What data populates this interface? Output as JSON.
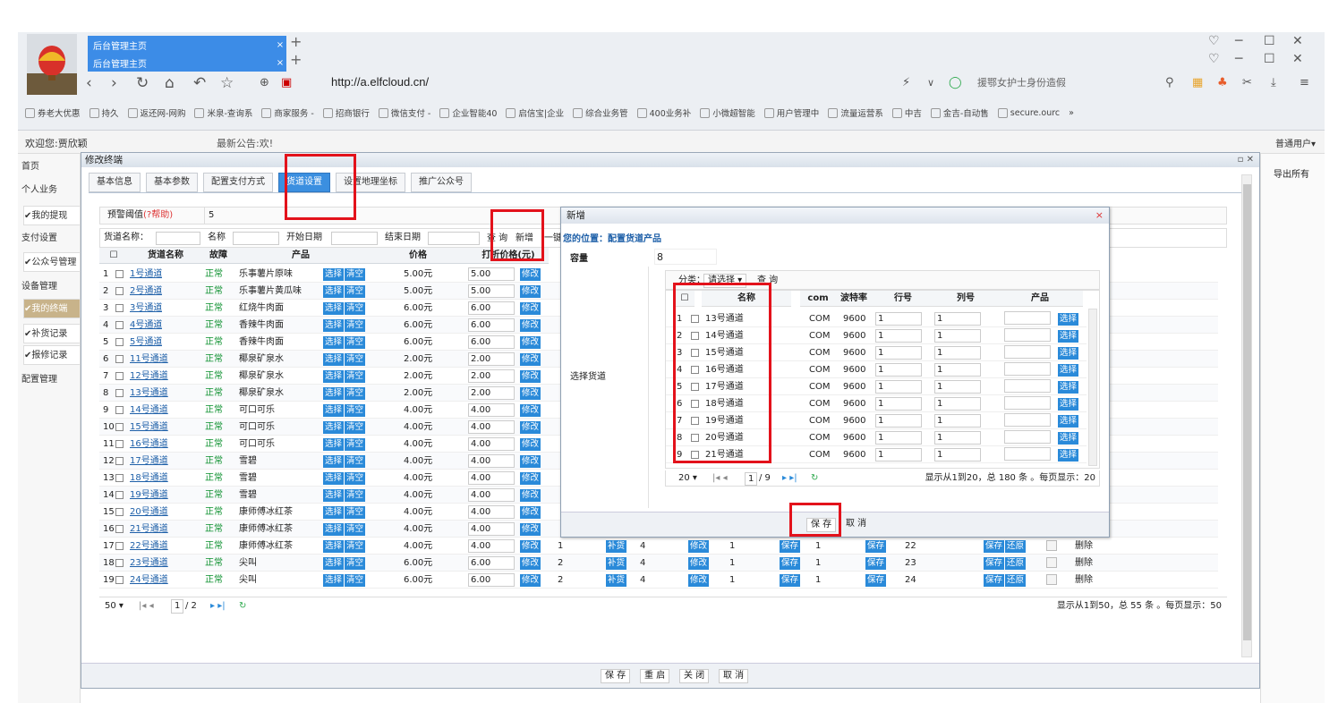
{
  "browser": {
    "tabs": [
      {
        "title": "后台管理主页",
        "close": "×"
      },
      {
        "title": "后台管理主页",
        "close": "×"
      }
    ],
    "new_tab": "+",
    "url": "http://a.elfcloud.cn/",
    "search_text": "援鄂女护士身份造假",
    "window_controls": [
      "─",
      "☐",
      "✕"
    ],
    "bookmarks": [
      "券老大优惠",
      "持久",
      "返还网-网购",
      "米泉-查询系",
      "商家服务 -",
      "招商银行",
      "微信支付 -",
      "企业智能40",
      "启信宝|企业",
      "综合业务管",
      "400业务补",
      "小微超智能",
      "用户管理中",
      "流量运营系",
      "中吉",
      "金吉-自动售",
      "secure.ourc"
    ],
    "bookmarks_more": "»"
  },
  "app": {
    "welcome": "欢迎您:贾欣颖",
    "notice": "最新公告:欢!",
    "user_type": "普通用户▾",
    "export_all": "导出所有"
  },
  "sidebar": [
    {
      "label": "首页"
    },
    {
      "label": "个人业务"
    },
    {
      "label": "✔我的提现"
    },
    {
      "label": "支付设置"
    },
    {
      "label": "✔公众号管理"
    },
    {
      "label": "设备管理"
    },
    {
      "label": "✔我的终端"
    },
    {
      "label": "✔补货记录"
    },
    {
      "label": "✔报修记录"
    },
    {
      "label": "配置管理"
    }
  ],
  "dialog": {
    "title": "修改终端",
    "tabs": [
      "基本信息",
      "基本参数",
      "配置支付方式",
      "货道设置",
      "设置地理坐标",
      "推广公众号"
    ],
    "active_tab": "货道设置",
    "warn_label": "预警阈值",
    "warn_help": "(?帮助)",
    "warn_value": "5",
    "filter": {
      "channel_name": "货道名称：",
      "name": "名称",
      "start_date": "开始日期",
      "end_date": "结束日期",
      "query": "查 询",
      "add": "新增",
      "extra": "一键"
    },
    "columns": [
      "☐",
      "货道名称",
      "故障",
      "产品",
      "价格",
      "打折价格(元)"
    ],
    "buttons": {
      "select": "选择",
      "clear": "清空",
      "modify": "修改",
      "restock": "补货",
      "save": "保存",
      "restore": "还原",
      "delete": "删除"
    },
    "rows": [
      {
        "no": "1",
        "name": "1号通道",
        "status": "正常",
        "product": "乐事薯片原味",
        "price": "5.00元",
        "discount": "5.00"
      },
      {
        "no": "2",
        "name": "2号通道",
        "status": "正常",
        "product": "乐事薯片黄瓜味",
        "price": "5.00元",
        "discount": "5.00"
      },
      {
        "no": "3",
        "name": "3号通道",
        "status": "正常",
        "product": "红烧牛肉面",
        "price": "6.00元",
        "discount": "6.00"
      },
      {
        "no": "4",
        "name": "4号通道",
        "status": "正常",
        "product": "香辣牛肉面",
        "price": "6.00元",
        "discount": "6.00"
      },
      {
        "no": "5",
        "name": "5号通道",
        "status": "正常",
        "product": "香辣牛肉面",
        "price": "6.00元",
        "discount": "6.00"
      },
      {
        "no": "6",
        "name": "11号通道",
        "status": "正常",
        "product": "椰泉矿泉水",
        "price": "2.00元",
        "discount": "2.00"
      },
      {
        "no": "7",
        "name": "12号通道",
        "status": "正常",
        "product": "椰泉矿泉水",
        "price": "2.00元",
        "discount": "2.00"
      },
      {
        "no": "8",
        "name": "13号通道",
        "status": "正常",
        "product": "椰泉矿泉水",
        "price": "2.00元",
        "discount": "2.00"
      },
      {
        "no": "9",
        "name": "14号通道",
        "status": "正常",
        "product": "可口可乐",
        "price": "4.00元",
        "discount": "4.00"
      },
      {
        "no": "10",
        "name": "15号通道",
        "status": "正常",
        "product": "可口可乐",
        "price": "4.00元",
        "discount": "4.00"
      },
      {
        "no": "11",
        "name": "16号通道",
        "status": "正常",
        "product": "可口可乐",
        "price": "4.00元",
        "discount": "4.00"
      },
      {
        "no": "12",
        "name": "17号通道",
        "status": "正常",
        "product": "雪碧",
        "price": "4.00元",
        "discount": "4.00"
      },
      {
        "no": "13",
        "name": "18号通道",
        "status": "正常",
        "product": "雪碧",
        "price": "4.00元",
        "discount": "4.00"
      },
      {
        "no": "14",
        "name": "19号通道",
        "status": "正常",
        "product": "雪碧",
        "price": "4.00元",
        "discount": "4.00"
      },
      {
        "no": "15",
        "name": "20号通道",
        "status": "正常",
        "product": "康师傅冰红茶",
        "price": "4.00元",
        "discount": "4.00"
      },
      {
        "no": "16",
        "name": "21号通道",
        "status": "正常",
        "product": "康师傅冰红茶",
        "price": "4.00元",
        "discount": "4.00"
      },
      {
        "no": "17",
        "name": "22号通道",
        "status": "正常",
        "product": "康师傅冰红茶",
        "price": "4.00元",
        "discount": "4.00",
        "stock": "1",
        "cap": "4",
        "row": "1",
        "col": "1",
        "seq": "22"
      },
      {
        "no": "18",
        "name": "23号通道",
        "status": "正常",
        "product": "尖叫",
        "price": "6.00元",
        "discount": "6.00",
        "stock": "2",
        "cap": "4",
        "row": "1",
        "col": "1",
        "seq": "23"
      },
      {
        "no": "19",
        "name": "24号通道",
        "status": "正常",
        "product": "尖叫",
        "price": "6.00元",
        "discount": "6.00",
        "stock": "2",
        "cap": "4",
        "row": "1",
        "col": "1",
        "seq": "24"
      }
    ],
    "pager": {
      "page_size": "50",
      "page": "1",
      "total_pages": "/ 2",
      "summary": "显示从1到50，总 55 条 。每页显示：50"
    },
    "bottom_buttons": [
      "保 存",
      "重 启",
      "关 闭",
      "取 消"
    ]
  },
  "popup": {
    "title": "新增",
    "close": "×",
    "path": "您的位置：配置货道产品",
    "capacity_label": "容量",
    "capacity_value": "8",
    "select_label": "选择货道",
    "category_label": "分类：",
    "category_value": "请选择 ▾",
    "query": "查 询",
    "columns": [
      "☐",
      "名称",
      "com",
      "波特率",
      "行号",
      "列号",
      "产品"
    ],
    "select_btn": "选择",
    "rows": [
      {
        "no": "1",
        "name": "13号通道",
        "com": "COM",
        "baud": "9600",
        "row": "1",
        "col": "1"
      },
      {
        "no": "2",
        "name": "14号通道",
        "com": "COM",
        "baud": "9600",
        "row": "1",
        "col": "1"
      },
      {
        "no": "3",
        "name": "15号通道",
        "com": "COM",
        "baud": "9600",
        "row": "1",
        "col": "1"
      },
      {
        "no": "4",
        "name": "16号通道",
        "com": "COM",
        "baud": "9600",
        "row": "1",
        "col": "1"
      },
      {
        "no": "5",
        "name": "17号通道",
        "com": "COM",
        "baud": "9600",
        "row": "1",
        "col": "1"
      },
      {
        "no": "6",
        "name": "18号通道",
        "com": "COM",
        "baud": "9600",
        "row": "1",
        "col": "1"
      },
      {
        "no": "7",
        "name": "19号通道",
        "com": "COM",
        "baud": "9600",
        "row": "1",
        "col": "1"
      },
      {
        "no": "8",
        "name": "20号通道",
        "com": "COM",
        "baud": "9600",
        "row": "1",
        "col": "1"
      },
      {
        "no": "9",
        "name": "21号通道",
        "com": "COM",
        "baud": "9600",
        "row": "1",
        "col": "1"
      }
    ],
    "pager": {
      "page_size": "20",
      "page": "1",
      "total_pages": "/ 9",
      "summary": "显示从1到20，总 180 条 。每页显示：20"
    },
    "save": "保 存",
    "cancel": "取 消"
  },
  "colors": {
    "accent": "#3b8fe0",
    "highlight": "#e3121b",
    "status_ok": "#0a8f2c"
  }
}
